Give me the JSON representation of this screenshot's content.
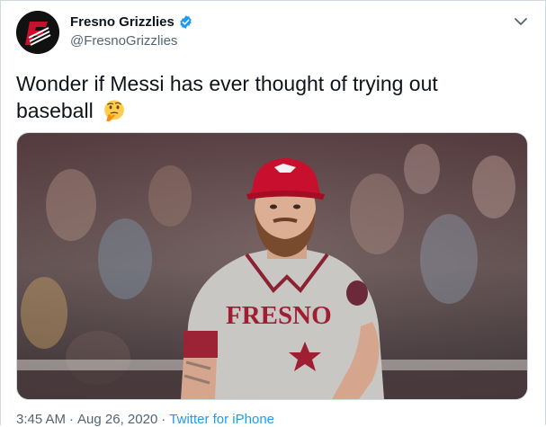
{
  "tweet": {
    "display_name": "Fresno Grizzlies",
    "handle": "@FresnoGrizzlies",
    "text": "Wonder if Messi has ever thought of trying out baseball",
    "emoji": "thinking-face",
    "time": "3:45 AM",
    "date": "Aug 26, 2020",
    "source": "Twitter for iPhone",
    "separator": "·"
  },
  "media": {
    "jersey_text": "FRESNO"
  },
  "colors": {
    "accent": "#1d9bf0",
    "brand_red": "#c8102e",
    "text": "#0f1419",
    "muted": "#536471"
  }
}
